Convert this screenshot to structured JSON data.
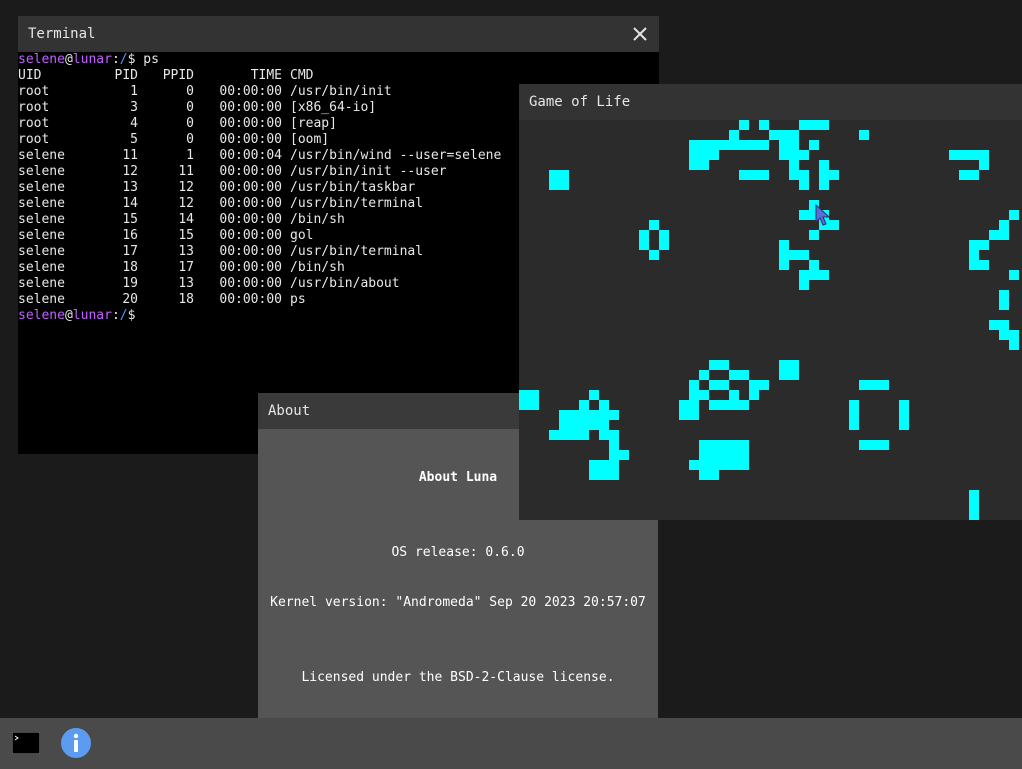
{
  "terminal": {
    "title": "Terminal",
    "prompt": {
      "user": "selene",
      "at": "@",
      "host": "lunar",
      "colon": ":",
      "path": "/",
      "dollar": "$ "
    },
    "command": "ps",
    "header": {
      "uid": "UID",
      "pid": "PID",
      "ppid": "PPID",
      "time": "TIME",
      "cmd": "CMD"
    },
    "rows": [
      {
        "uid": "root",
        "pid": "1",
        "ppid": "0",
        "time": "00:00:00",
        "cmd": "/usr/bin/init"
      },
      {
        "uid": "root",
        "pid": "3",
        "ppid": "0",
        "time": "00:00:00",
        "cmd": "[x86_64-io]"
      },
      {
        "uid": "root",
        "pid": "4",
        "ppid": "0",
        "time": "00:00:00",
        "cmd": "[reap]"
      },
      {
        "uid": "root",
        "pid": "5",
        "ppid": "0",
        "time": "00:00:00",
        "cmd": "[oom]"
      },
      {
        "uid": "selene",
        "pid": "11",
        "ppid": "1",
        "time": "00:00:04",
        "cmd": "/usr/bin/wind --user=selene"
      },
      {
        "uid": "selene",
        "pid": "12",
        "ppid": "11",
        "time": "00:00:00",
        "cmd": "/usr/bin/init --user"
      },
      {
        "uid": "selene",
        "pid": "13",
        "ppid": "12",
        "time": "00:00:00",
        "cmd": "/usr/bin/taskbar"
      },
      {
        "uid": "selene",
        "pid": "14",
        "ppid": "12",
        "time": "00:00:00",
        "cmd": "/usr/bin/terminal"
      },
      {
        "uid": "selene",
        "pid": "15",
        "ppid": "14",
        "time": "00:00:00",
        "cmd": "/bin/sh"
      },
      {
        "uid": "selene",
        "pid": "16",
        "ppid": "15",
        "time": "00:00:00",
        "cmd": "gol"
      },
      {
        "uid": "selene",
        "pid": "17",
        "ppid": "13",
        "time": "00:00:00",
        "cmd": "/usr/bin/terminal"
      },
      {
        "uid": "selene",
        "pid": "18",
        "ppid": "17",
        "time": "00:00:00",
        "cmd": "/bin/sh"
      },
      {
        "uid": "selene",
        "pid": "19",
        "ppid": "13",
        "time": "00:00:00",
        "cmd": "/usr/bin/about"
      },
      {
        "uid": "selene",
        "pid": "20",
        "ppid": "18",
        "time": "00:00:00",
        "cmd": "ps"
      }
    ]
  },
  "gol": {
    "title": "Game of Life",
    "cell_color": "#00ffff"
  },
  "about": {
    "title": "About",
    "heading": "About Luna",
    "os_release": "OS release: 0.6.0",
    "kernel_version": "Kernel version: \"Andromeda\" Sep 20 2023 20:57:07",
    "license": "Licensed under the BSD-2-Clause license."
  },
  "taskbar": {
    "items": [
      {
        "icon": "terminal-icon"
      },
      {
        "icon": "info-icon"
      }
    ]
  },
  "colors": {
    "desktop": "#1b1b1b",
    "titlebar": "#333333",
    "taskbar": "#4a4a4a",
    "prompt_user": "#c060ff",
    "prompt_path": "#4a9aff",
    "info_icon": "#5b9cf0"
  }
}
